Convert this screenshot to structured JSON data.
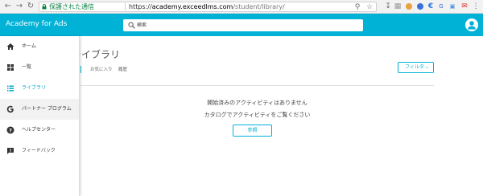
{
  "browser": {
    "secure_label": "保護された通信",
    "url_scheme": "https://",
    "url_host": "academy.exceedlms.com",
    "url_path": "/student/library/"
  },
  "header": {
    "brand": "Academy for Ads",
    "search_placeholder": "検索"
  },
  "sidebar": {
    "items": [
      {
        "label": "ホーム",
        "icon": "home-icon"
      },
      {
        "label": "一覧",
        "icon": "grid-icon"
      },
      {
        "label": "ライブラリ",
        "icon": "library-list-icon"
      },
      {
        "label": "パートナー プログラム",
        "icon": "google-g-icon"
      },
      {
        "label": "ヘルプセンター",
        "icon": "help-icon"
      },
      {
        "label": "フィードバック",
        "icon": "feedback-icon"
      }
    ]
  },
  "main": {
    "title": "ライブラリ",
    "tabs": [
      {
        "label": "お気に入り"
      },
      {
        "label": "履歴"
      }
    ],
    "filter_label": "フィルタ",
    "empty_title": "開始済みのアクティビティはありません",
    "empty_subtitle": "カタログでアクティビティをご覧ください",
    "browse_label": "参照"
  },
  "colors": {
    "accent": "#00b2d6",
    "secure_green": "#0b8043"
  }
}
